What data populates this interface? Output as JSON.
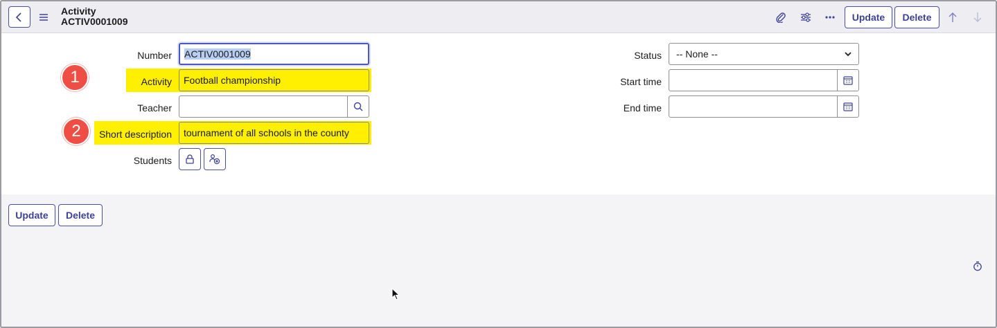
{
  "header": {
    "title": "Activity",
    "record_id": "ACTIV0001009",
    "update_label": "Update",
    "delete_label": "Delete",
    "icons": [
      "chevron-left-icon",
      "menu-icon",
      "paperclip-icon",
      "sliders-icon",
      "more-icon",
      "arrow-up-icon",
      "arrow-down-icon"
    ]
  },
  "form": {
    "number_label": "Number",
    "number_value": "ACTIV0001009",
    "activity_label": "Activity",
    "activity_value": "Football championship",
    "teacher_label": "Teacher",
    "teacher_value": "",
    "short_description_label": "Short description",
    "short_description_value": "tournament of all schools in the county",
    "students_label": "Students",
    "status_label": "Status",
    "status_value": "-- None --",
    "start_time_label": "Start time",
    "start_time_value": "",
    "end_time_label": "End time",
    "end_time_value": ""
  },
  "annotations": {
    "badge1": "1",
    "badge2": "2"
  },
  "footer": {
    "update_label": "Update",
    "delete_label": "Delete"
  },
  "colors": {
    "accent": "#4a4fa6",
    "highlight": "#ffef00",
    "badge": "#ef4e45"
  }
}
